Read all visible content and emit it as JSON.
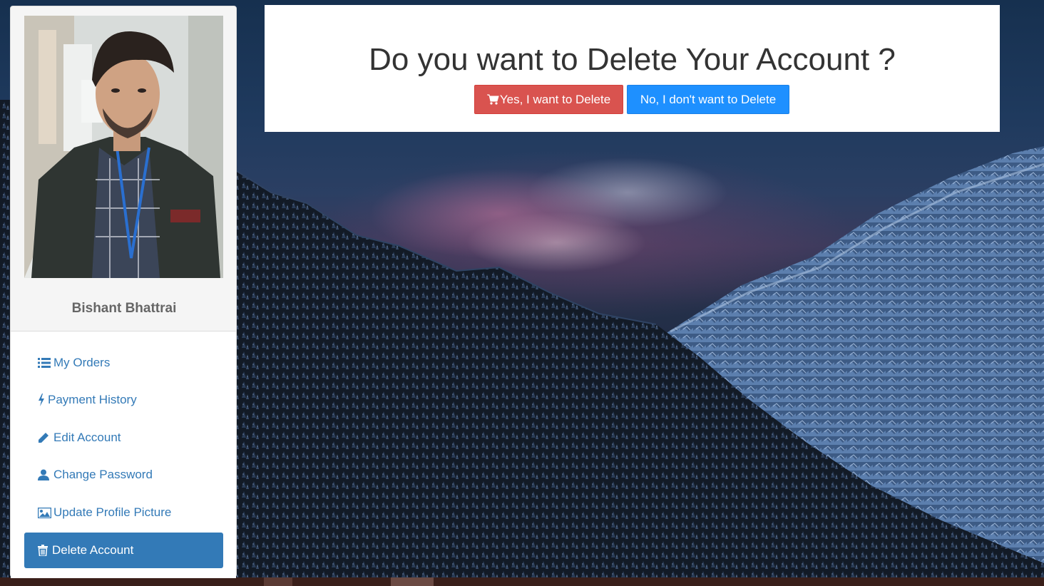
{
  "profile": {
    "name": "Bishant Bhattrai"
  },
  "menu": {
    "items": [
      {
        "label": "My Orders",
        "icon": "list-icon"
      },
      {
        "label": "Payment History",
        "icon": "bolt-icon"
      },
      {
        "label": "Edit Account",
        "icon": "pencil-icon"
      },
      {
        "label": "Change Password",
        "icon": "user-icon"
      },
      {
        "label": "Update Profile Picture",
        "icon": "image-icon"
      },
      {
        "label": "Delete Account",
        "icon": "trash-icon",
        "active": true
      }
    ]
  },
  "dialog": {
    "title": "Do you want to Delete Your Account ?",
    "yes_label": "Yes, I want to Delete",
    "yes_icon": "cart-icon",
    "no_label": "No, I don't want to Delete"
  },
  "colors": {
    "accent": "#337ab7",
    "danger": "#d9534f",
    "primary": "#1e90ff"
  }
}
